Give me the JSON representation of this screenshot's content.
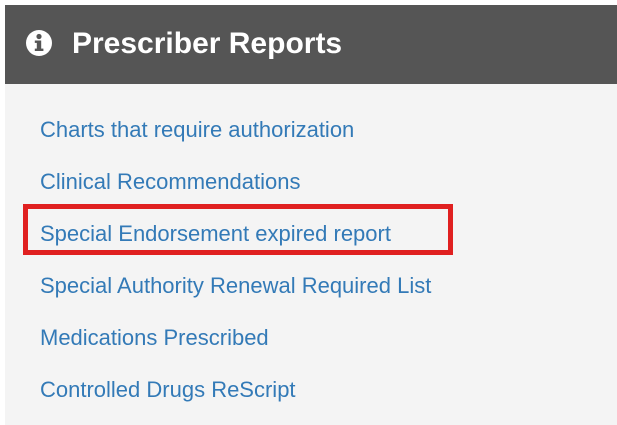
{
  "panel": {
    "title": "Prescriber Reports",
    "icon": "info-circle-icon"
  },
  "reports": [
    {
      "label": "Charts that require authorization"
    },
    {
      "label": "Clinical Recommendations"
    },
    {
      "label": "Special Endorsement expired report"
    },
    {
      "label": "Special Authority Renewal Required List"
    },
    {
      "label": "Medications Prescribed"
    },
    {
      "label": "Controlled Drugs ReScript"
    }
  ],
  "colors": {
    "header_background": "#555555",
    "panel_background": "#f4f4f4",
    "link": "#337ab7",
    "highlight": "#e02020"
  }
}
